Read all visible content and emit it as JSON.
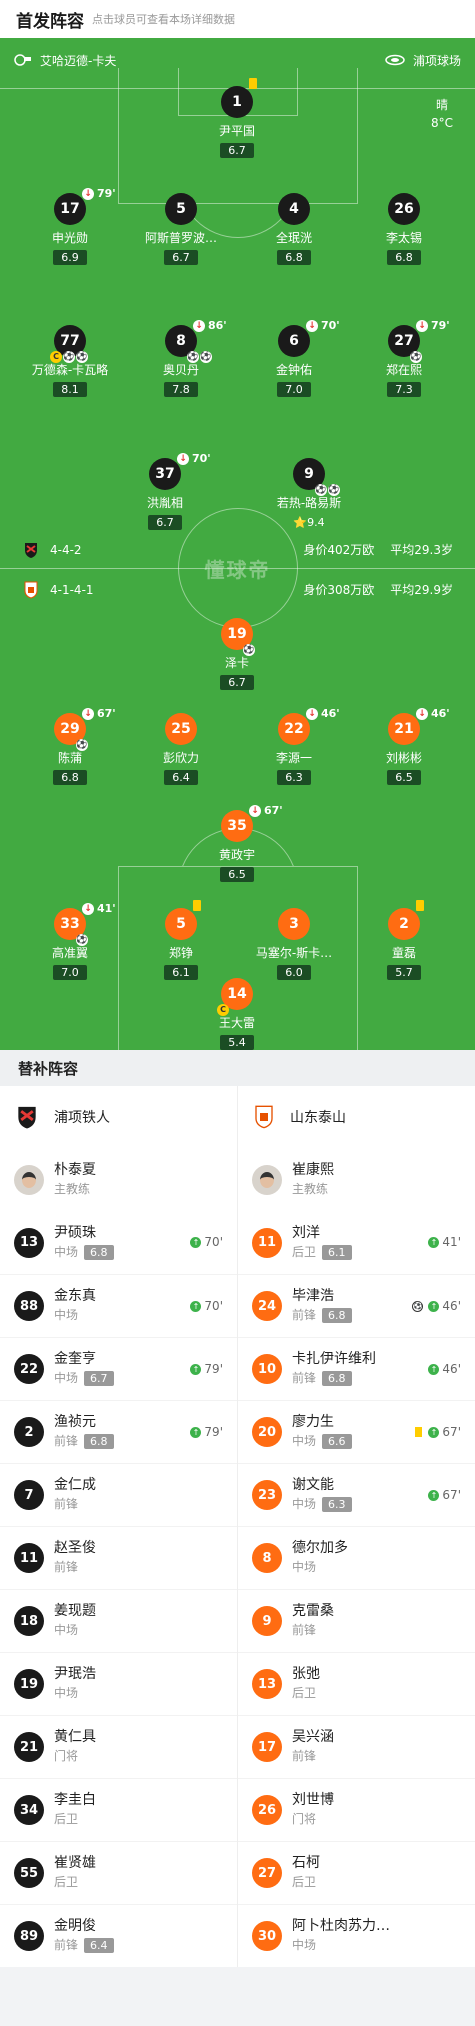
{
  "header": {
    "title": "首发阵容",
    "subtitle": "点击球员可查看本场详细数据"
  },
  "teams": {
    "home_label": "艾哈迈德-卡夫",
    "away_label": "浦项球场"
  },
  "weather": {
    "condition": "晴",
    "temp": "8°C"
  },
  "watermark": "懂球帝",
  "home_formation": {
    "shape": "4-4-2",
    "value": "身价402万欧",
    "avg_age": "平均29.3岁"
  },
  "away_formation": {
    "shape": "4-1-4-1",
    "value": "身价308万欧",
    "avg_age": "平均29.9岁"
  },
  "home_players": [
    {
      "num": "1",
      "name": "尹平国",
      "rating": "6.7"
    },
    {
      "num": "17",
      "name": "申光勋",
      "rating": "6.9",
      "sub_min": "79'"
    },
    {
      "num": "5",
      "name": "阿斯普罗波…",
      "rating": "6.7"
    },
    {
      "num": "4",
      "name": "全珉洸",
      "rating": "6.8"
    },
    {
      "num": "26",
      "name": "李太锡",
      "rating": "6.8"
    },
    {
      "num": "77",
      "name": "万德森-卡瓦略",
      "rating": "8.1"
    },
    {
      "num": "8",
      "name": "奥贝丹",
      "rating": "7.8",
      "sub_min": "86'"
    },
    {
      "num": "6",
      "name": "金钟佑",
      "rating": "7.0",
      "sub_min": "70'"
    },
    {
      "num": "27",
      "name": "郑在熙",
      "rating": "7.3",
      "sub_min": "79'"
    },
    {
      "num": "37",
      "name": "洪胤相",
      "rating": "6.7",
      "sub_min": "70'"
    },
    {
      "num": "9",
      "name": "若热-路易斯",
      "rating": "9.4"
    }
  ],
  "away_players": [
    {
      "num": "19",
      "name": "泽卡",
      "rating": "6.7"
    },
    {
      "num": "29",
      "name": "陈蒲",
      "rating": "6.8",
      "sub_min": "67'"
    },
    {
      "num": "25",
      "name": "彭欣力",
      "rating": "6.4"
    },
    {
      "num": "22",
      "name": "李源一",
      "rating": "6.3",
      "sub_min": "46'"
    },
    {
      "num": "21",
      "name": "刘彬彬",
      "rating": "6.5",
      "sub_min": "46'"
    },
    {
      "num": "35",
      "name": "黄政宇",
      "rating": "6.5",
      "sub_min": "67'"
    },
    {
      "num": "33",
      "name": "高准翼",
      "rating": "7.0",
      "sub_min": "41'"
    },
    {
      "num": "5",
      "name": "郑铮",
      "rating": "6.1"
    },
    {
      "num": "3",
      "name": "马塞尔-斯卡…",
      "rating": "6.0"
    },
    {
      "num": "2",
      "name": "童磊",
      "rating": "5.7"
    },
    {
      "num": "14",
      "name": "王大雷",
      "rating": "5.4"
    }
  ],
  "bench": {
    "title": "替补阵容",
    "home_team": "浦项铁人",
    "away_team": "山东泰山",
    "home_coach": {
      "name": "朴泰夏",
      "role": "主教练"
    },
    "away_coach": {
      "name": "崔康熙",
      "role": "主教练"
    },
    "home": [
      {
        "num": "13",
        "name": "尹硕珠",
        "pos": "中场",
        "rating": "6.8",
        "sub": "70'"
      },
      {
        "num": "88",
        "name": "金东真",
        "pos": "中场",
        "rating": "",
        "sub": "70'"
      },
      {
        "num": "22",
        "name": "金奎亨",
        "pos": "中场",
        "rating": "6.7",
        "sub": "79'"
      },
      {
        "num": "2",
        "name": "渔祯元",
        "pos": "前锋",
        "rating": "6.8",
        "sub": "79'"
      },
      {
        "num": "7",
        "name": "金仁成",
        "pos": "前锋",
        "rating": "",
        "sub": ""
      },
      {
        "num": "11",
        "name": "赵圣俊",
        "pos": "前锋",
        "rating": "",
        "sub": ""
      },
      {
        "num": "18",
        "name": "姜现题",
        "pos": "中场",
        "rating": "",
        "sub": ""
      },
      {
        "num": "19",
        "name": "尹珉浩",
        "pos": "中场",
        "rating": "",
        "sub": ""
      },
      {
        "num": "21",
        "name": "黄仁具",
        "pos": "门将",
        "rating": "",
        "sub": ""
      },
      {
        "num": "34",
        "name": "李圭白",
        "pos": "后卫",
        "rating": "",
        "sub": ""
      },
      {
        "num": "55",
        "name": "崔贤雄",
        "pos": "后卫",
        "rating": "",
        "sub": ""
      },
      {
        "num": "89",
        "name": "金明俊",
        "pos": "前锋",
        "rating": "6.4",
        "sub": ""
      }
    ],
    "away": [
      {
        "num": "11",
        "name": "刘洋",
        "pos": "后卫",
        "rating": "6.1",
        "sub": "41'"
      },
      {
        "num": "24",
        "name": "毕津浩",
        "pos": "前锋",
        "rating": "6.8",
        "sub": "46'"
      },
      {
        "num": "10",
        "name": "卡扎伊许维利",
        "pos": "前锋",
        "rating": "6.8",
        "sub": "46'"
      },
      {
        "num": "20",
        "name": "廖力生",
        "pos": "中场",
        "rating": "6.6",
        "sub": "67'"
      },
      {
        "num": "23",
        "name": "谢文能",
        "pos": "中场",
        "rating": "6.3",
        "sub": "67'"
      },
      {
        "num": "8",
        "name": "德尔加多",
        "pos": "中场",
        "rating": "",
        "sub": ""
      },
      {
        "num": "9",
        "name": "克雷桑",
        "pos": "前锋",
        "rating": "",
        "sub": ""
      },
      {
        "num": "13",
        "name": "张弛",
        "pos": "后卫",
        "rating": "",
        "sub": ""
      },
      {
        "num": "17",
        "name": "吴兴涵",
        "pos": "前锋",
        "rating": "",
        "sub": ""
      },
      {
        "num": "26",
        "name": "刘世博",
        "pos": "门将",
        "rating": "",
        "sub": ""
      },
      {
        "num": "27",
        "name": "石柯",
        "pos": "后卫",
        "rating": "",
        "sub": ""
      },
      {
        "num": "30",
        "name": "阿卜杜肉苏力…",
        "pos": "中场",
        "rating": "",
        "sub": ""
      }
    ]
  }
}
